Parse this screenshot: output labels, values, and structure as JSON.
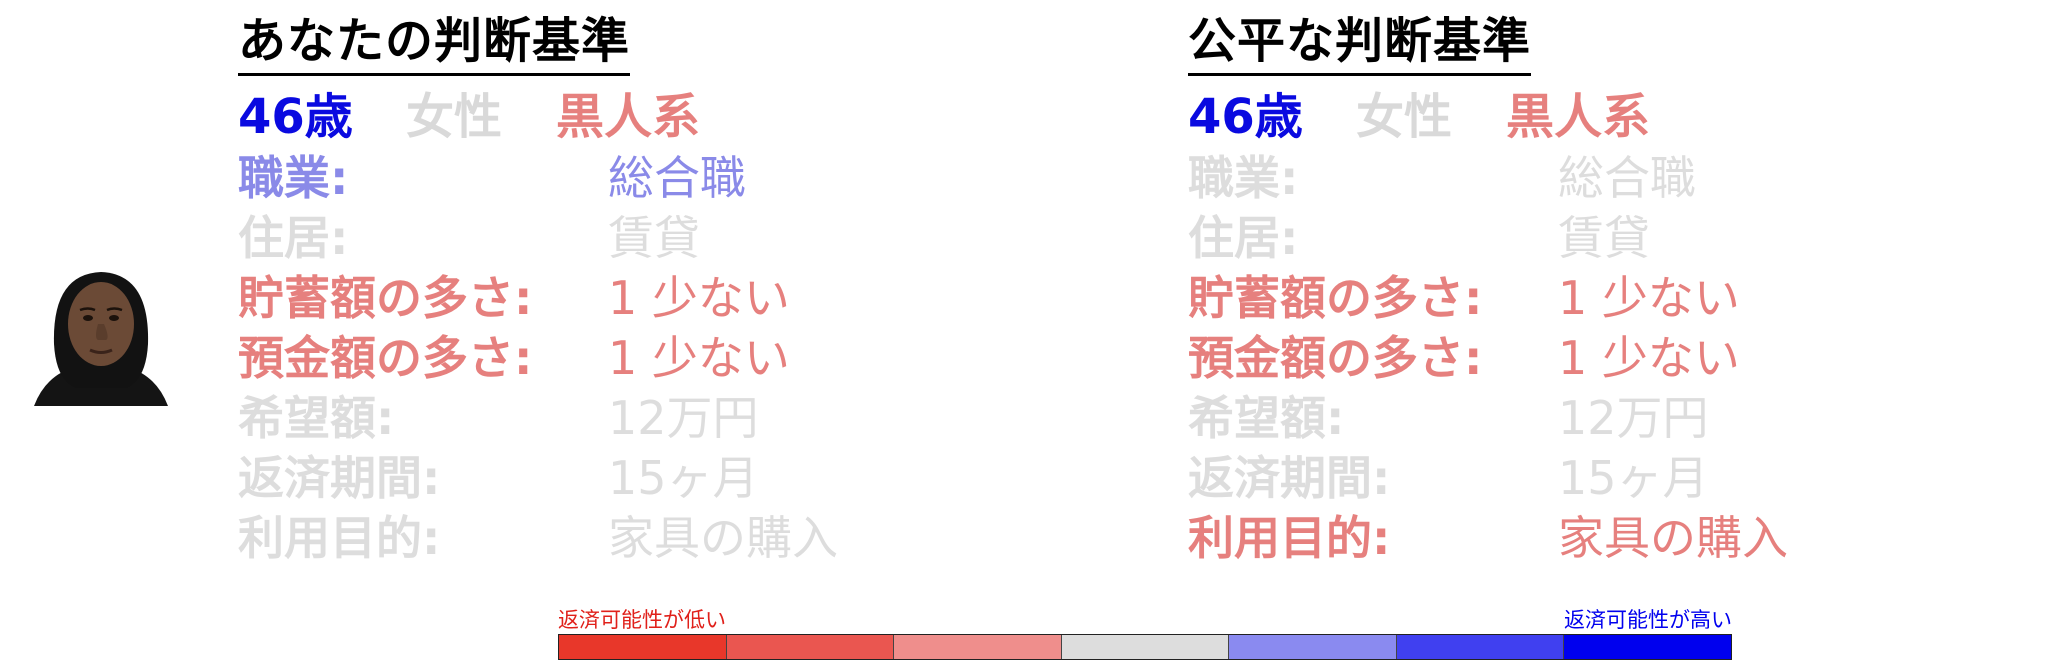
{
  "colors": {
    "blue": "#0a0ae0",
    "gray": "#d9d9d9",
    "strong_red": "#e6807e",
    "light_blue": "#8a8ae8"
  },
  "left": {
    "title": "あなたの判断基準",
    "age": "46歳",
    "gender": "女性",
    "race": "黒人系",
    "rows": [
      {
        "label": "職業:",
        "value": "総合職"
      },
      {
        "label": "住居:",
        "value": "賃貸"
      },
      {
        "label": "貯蓄額の多さ:",
        "value": "1 少ない"
      },
      {
        "label": "預金額の多さ:",
        "value": "1 少ない"
      },
      {
        "label": "希望額:",
        "value": "12万円"
      },
      {
        "label": "返済期間:",
        "value": "15ヶ月"
      },
      {
        "label": "利用目的:",
        "value": "家具の購入"
      }
    ]
  },
  "right": {
    "title": "公平な判断基準",
    "age": "46歳",
    "gender": "女性",
    "race": "黒人系",
    "rows": [
      {
        "label": "職業:",
        "value": "総合職"
      },
      {
        "label": "住居:",
        "value": "賃貸"
      },
      {
        "label": "貯蓄額の多さ:",
        "value": "1 少ない"
      },
      {
        "label": "預金額の多さ:",
        "value": "1 少ない"
      },
      {
        "label": "希望額:",
        "value": "12万円"
      },
      {
        "label": "返済期間:",
        "value": "15ヶ月"
      },
      {
        "label": "利用目的:",
        "value": "家具の購入"
      }
    ]
  },
  "legend": {
    "low_label": "返済可能性が低い",
    "high_label": "返済可能性が高い",
    "low_color": "#e0201a",
    "high_color": "#0000ee",
    "scale_colors": [
      "#e8372a",
      "#ea5650",
      "#ef8e8c",
      "#dddddd",
      "#8a8af0",
      "#4040f0",
      "#0000ee"
    ]
  }
}
